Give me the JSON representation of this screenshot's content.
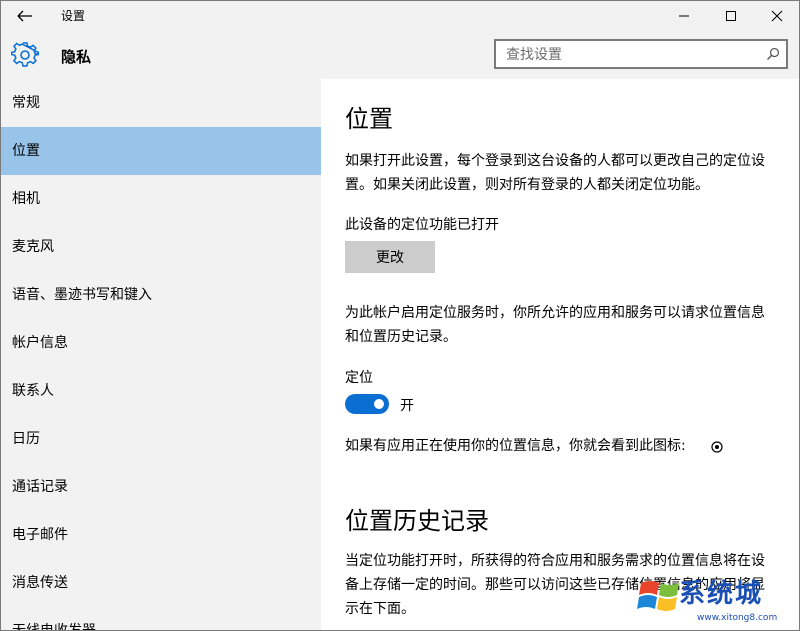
{
  "titlebar": {
    "title": "设置",
    "back_icon": "back-arrow-icon",
    "controls": [
      "minimize-icon",
      "maximize-icon",
      "close-icon"
    ]
  },
  "header": {
    "icon": "gear-icon",
    "title": "隐私",
    "search_placeholder": "查找设置",
    "search_value": ""
  },
  "sidebar": {
    "items": [
      {
        "label": "常规",
        "active": false
      },
      {
        "label": "位置",
        "active": true
      },
      {
        "label": "相机",
        "active": false
      },
      {
        "label": "麦克风",
        "active": false
      },
      {
        "label": "语音、墨迹书写和键入",
        "active": false
      },
      {
        "label": "帐户信息",
        "active": false
      },
      {
        "label": "联系人",
        "active": false
      },
      {
        "label": "日历",
        "active": false
      },
      {
        "label": "通话记录",
        "active": false
      },
      {
        "label": "电子邮件",
        "active": false
      },
      {
        "label": "消息传送",
        "active": false
      },
      {
        "label": "无线电收发器",
        "active": false
      }
    ]
  },
  "main": {
    "heading": "位置",
    "intro": "如果打开此设置，每个登录到这台设备的人都可以更改自己的定位设置。如果关闭此设置，则对所有登录的人都关闭定位功能。",
    "device_status": "此设备的定位功能已打开",
    "change_button": "更改",
    "account_desc": "为此帐户启用定位服务时，你所允许的应用和服务可以请求位置信息和位置历史记录。",
    "location_label": "定位",
    "toggle_on": true,
    "toggle_state": "开",
    "icon_hint": "如果有应用正在使用你的位置信息，你就会看到此图标:",
    "history_heading": "位置历史记录",
    "history_desc": "当定位功能打开时，所获得的符合应用和服务需求的位置信息将在设备上存储一定的时间。那些可以访问这些已存储位置信息的应用将显示在下面。"
  },
  "watermark": {
    "text": "系统城",
    "url": "www.xitong8.com"
  },
  "colors": {
    "accent": "#0a6fd1",
    "active_nav": "#99c4ea",
    "chrome_bg": "#f2f2f2",
    "button_bg": "#cccccc"
  }
}
